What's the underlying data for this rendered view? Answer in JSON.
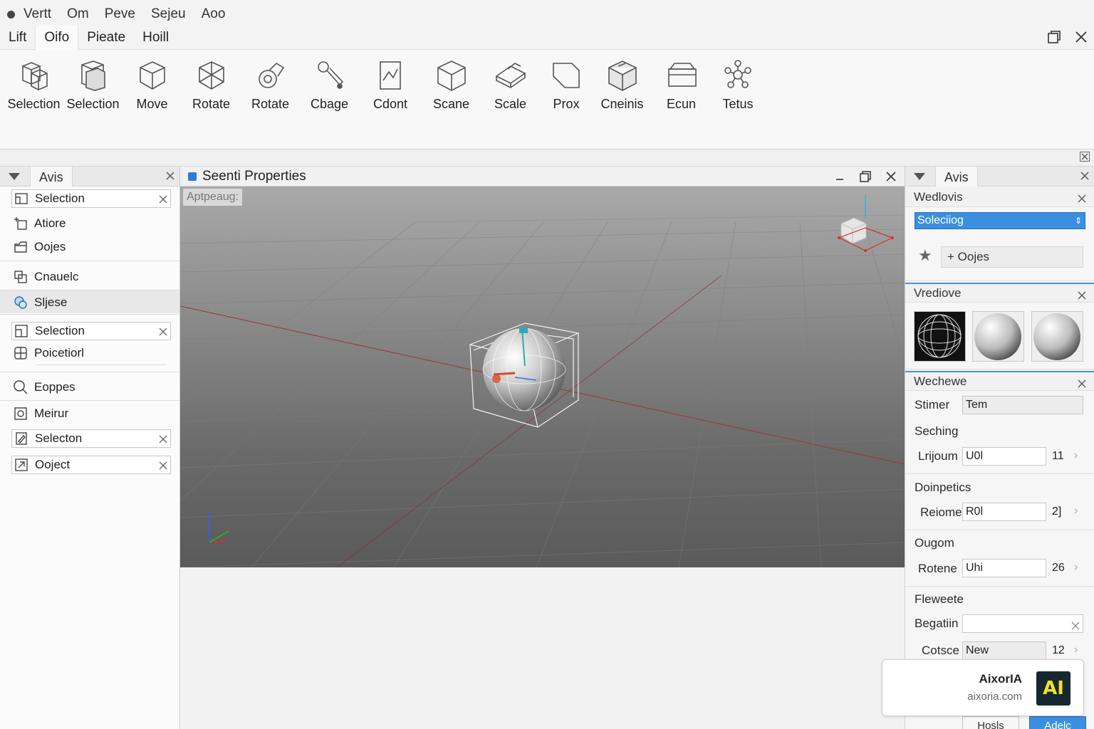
{
  "window_menu": [
    "Vertt",
    "Om",
    "Peve",
    "Sejeu",
    "Aoo"
  ],
  "menu_tabs": [
    {
      "label": "Lift",
      "active": false
    },
    {
      "label": "Oifo",
      "active": true
    },
    {
      "label": "Pieate",
      "active": false
    },
    {
      "label": "Hoill",
      "active": false
    }
  ],
  "toolbar": {
    "tools": [
      {
        "label": "Selection",
        "icon": "selection-cubes-icon"
      },
      {
        "label": "Selection",
        "icon": "selection-cube-icon"
      },
      {
        "label": "Move",
        "icon": "move-cube-icon"
      },
      {
        "label": "Rotate",
        "icon": "rotate-cube-icon"
      },
      {
        "label": "Rotate",
        "icon": "rotate-tool-icon"
      },
      {
        "label": "Cbage",
        "icon": "wand-icon"
      },
      {
        "label": "Cdont",
        "icon": "panel-icon"
      },
      {
        "label": "Scane",
        "icon": "scale-cube-icon"
      },
      {
        "label": "Scale",
        "icon": "scale-plane-icon"
      },
      {
        "label": "Prox",
        "icon": "proxy-icon"
      },
      {
        "label": "Cneinis",
        "icon": "box-icon"
      },
      {
        "label": "Ecun",
        "icon": "printer-icon"
      },
      {
        "label": "Tetus",
        "icon": "molecule-icon"
      }
    ]
  },
  "left_panel": {
    "tab_label": "Avis",
    "items": [
      {
        "label": "Selection",
        "icon": "layer-icon",
        "boxed": true
      },
      {
        "label": "Atiore",
        "icon": "add-frame-icon",
        "boxed": false
      },
      {
        "label": "Oojes",
        "icon": "folder-icon",
        "boxed": false
      },
      {
        "label": "Cnauelc",
        "icon": "duplicate-icon",
        "boxed": false
      },
      {
        "label": "Sljese",
        "icon": "palette-icon",
        "boxed": false,
        "highlighted": true
      },
      {
        "label": "Selection",
        "icon": "select-frame-icon",
        "boxed": true
      },
      {
        "label": "Poicetiorl",
        "icon": "grid-icon",
        "boxed": false
      },
      {
        "label": "Eoppes",
        "icon": "magnify-icon",
        "boxed": false
      },
      {
        "label": "Meirur",
        "icon": "target-icon",
        "boxed": false
      },
      {
        "label": "Selecton",
        "icon": "edit-doc-icon",
        "boxed": true
      },
      {
        "label": "Ooject",
        "icon": "link-icon",
        "boxed": true
      }
    ]
  },
  "viewport": {
    "title": "Seenti Properties",
    "label": "Aptpeaug:"
  },
  "right_panel": {
    "tab_label": "Avis",
    "section1": {
      "title": "Wedlovis",
      "dropdown_value": "Soleciiog",
      "add_label": "+ Oojes"
    },
    "section2": {
      "title": "Vrediove"
    },
    "section3": {
      "title": "Wechewe",
      "rows": [
        {
          "label": "Stimer",
          "value": "Tem"
        },
        {
          "label": "Seching"
        },
        {
          "label": "Lrijoum",
          "value": "U0l",
          "num": "11"
        },
        {
          "label": "Doinpetics"
        },
        {
          "label": "Reiome",
          "value": "R0l",
          "num": "2]"
        },
        {
          "label": "Ougom"
        },
        {
          "label": "Rotene",
          "value": "Uhi",
          "num": "26"
        },
        {
          "label": "Fleweete"
        },
        {
          "label": "Begatiin",
          "value": ""
        },
        {
          "label": "Cotsce",
          "value": "New",
          "num": "12"
        }
      ]
    },
    "buttons": {
      "secondary": "Hosls",
      "primary": "Adelc"
    }
  },
  "watermark": {
    "name": "AixorIA",
    "url": "aixoria.com",
    "logo_text": "AI"
  }
}
